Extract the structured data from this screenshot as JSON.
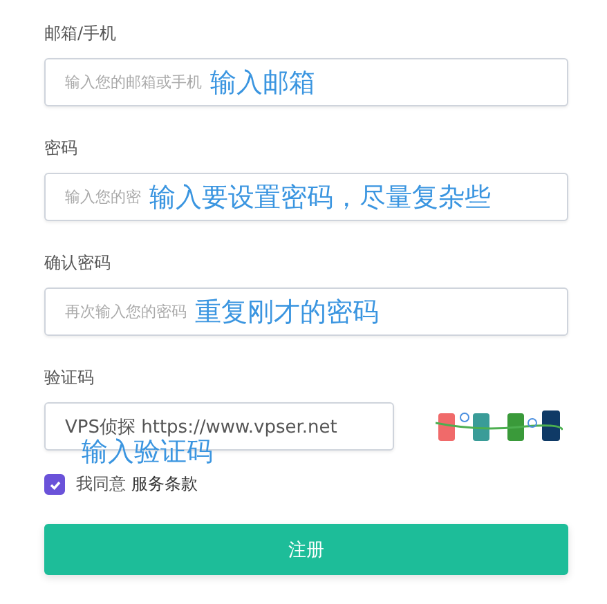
{
  "fields": [
    {
      "label": "邮箱/手机",
      "placeholder": "输入您的邮箱或手机",
      "annotation": "输入邮箱"
    },
    {
      "label": "密码",
      "placeholder": "输入您的密",
      "annotation": "输入要设置密码，尽量复杂些"
    },
    {
      "label": "确认密码",
      "placeholder": "再次输入您的密码",
      "annotation": "重复刚才的密码"
    }
  ],
  "captcha": {
    "label": "验证码",
    "value": "VPS侦探 https://www.vpser.net",
    "annotation": "输入验证码"
  },
  "agree": {
    "checked": true,
    "text": "我同意",
    "link": "服务条款"
  },
  "submit": {
    "label": "注册"
  }
}
